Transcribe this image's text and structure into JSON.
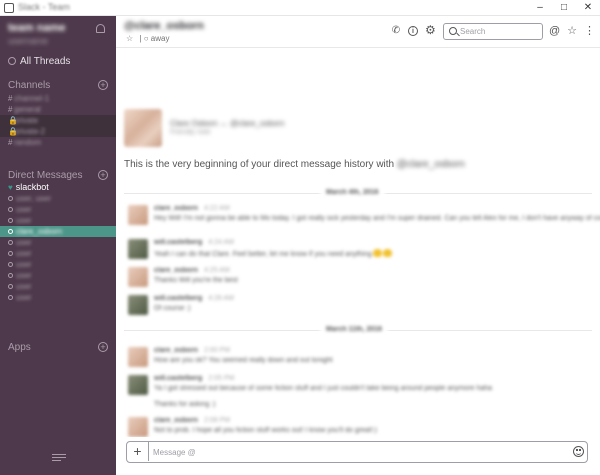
{
  "window": {
    "title": "Slack - Team",
    "min": "–",
    "max": "□",
    "close": "✕"
  },
  "sidebar": {
    "team_name": "team name",
    "team_user": "username",
    "all_threads": "All Threads",
    "channels_label": "Channels",
    "channels": [
      {
        "prefix": "#",
        "name": "channel-1",
        "locked": false
      },
      {
        "prefix": "#",
        "name": "general",
        "locked": false
      },
      {
        "prefix": "🔒",
        "name": "private",
        "locked": true
      },
      {
        "prefix": "🔒",
        "name": "private-2",
        "locked": true
      },
      {
        "prefix": "#",
        "name": "random",
        "locked": false
      }
    ],
    "dm_label": "Direct Messages",
    "dms": [
      {
        "name": "slackbot",
        "kind": "slackbot"
      },
      {
        "name": "user, user",
        "kind": "group"
      },
      {
        "name": "user",
        "kind": "user"
      },
      {
        "name": "user",
        "kind": "user"
      },
      {
        "name": "clare_osborn",
        "kind": "active"
      },
      {
        "name": "user",
        "kind": "user"
      },
      {
        "name": "user",
        "kind": "user"
      },
      {
        "name": "user",
        "kind": "user"
      },
      {
        "name": "user",
        "kind": "user"
      },
      {
        "name": "user",
        "kind": "user"
      },
      {
        "name": "user",
        "kind": "user"
      }
    ],
    "apps_label": "Apps",
    "add_symbol": "+"
  },
  "header": {
    "channel_name": "@clare_osborn",
    "star": "☆",
    "status_separator": "|",
    "status": "○ away",
    "phone_glyph": "✆",
    "info_glyph": "i",
    "gear_glyph": "⚙",
    "search_placeholder": "Search",
    "at_glyph": "@",
    "star_glyph": "☆",
    "more_glyph": "⋮"
  },
  "intro": {
    "names": "Clare Osborn  ↔  @clare_osborn",
    "sub": "Friendly note",
    "text_visible": "This is the very beginning of your direct message history with",
    "text_name": "@clare_osborn"
  },
  "days": [
    {
      "label": "March 4th, 2016"
    },
    {
      "label": "March 11th, 2016"
    }
  ],
  "messages": [
    {
      "author": "clare_osborn",
      "time": "4:22 AM",
      "text": "Hey Will! I'm not gonna be able to Mo today. I got really sick yesterday and I'm super drained. Can you tell Alex for me, I don't have anyway of contacting him",
      "text2": "",
      "emoji": false,
      "avatar": "clare"
    },
    {
      "author": "will.castelberg",
      "time": "4:24 AM",
      "text": "Yeah I can do that Clare. Feel better, let me know if you need anything",
      "text2": "",
      "emoji": true,
      "avatar": "will"
    },
    {
      "author": "clare_osborn",
      "time": "4:25 AM",
      "text": "Thanks Will you're the best",
      "text2": "",
      "emoji": false,
      "avatar": "clare"
    },
    {
      "author": "will.castelberg",
      "time": "4:26 AM",
      "text": "Of course :)",
      "text2": "",
      "emoji": false,
      "avatar": "will"
    },
    {
      "author": "clare_osborn",
      "time": "2:00 PM",
      "text": "How are you ok? You seemed really down and out tonight",
      "text2": "",
      "emoji": false,
      "avatar": "clare"
    },
    {
      "author": "will.castelberg",
      "time": "2:05 PM",
      "text": "Ya I got stressed out because of some fiction stuff and I just couldn't take being around people anymore haha",
      "text2": "Thanks for asking :)",
      "emoji": false,
      "avatar": "will"
    },
    {
      "author": "clare_osborn",
      "time": "2:08 PM",
      "text": "Not to prob. I hope all you fiction stuff works out! I know you'll do great!:)",
      "text2": "",
      "emoji": false,
      "avatar": "clare"
    }
  ],
  "composer": {
    "plus": "+",
    "placeholder": "Message @"
  },
  "colors": {
    "sidebar": "#4d394b",
    "active": "#4c9689",
    "sidebar_text": "#ab9ba9"
  }
}
